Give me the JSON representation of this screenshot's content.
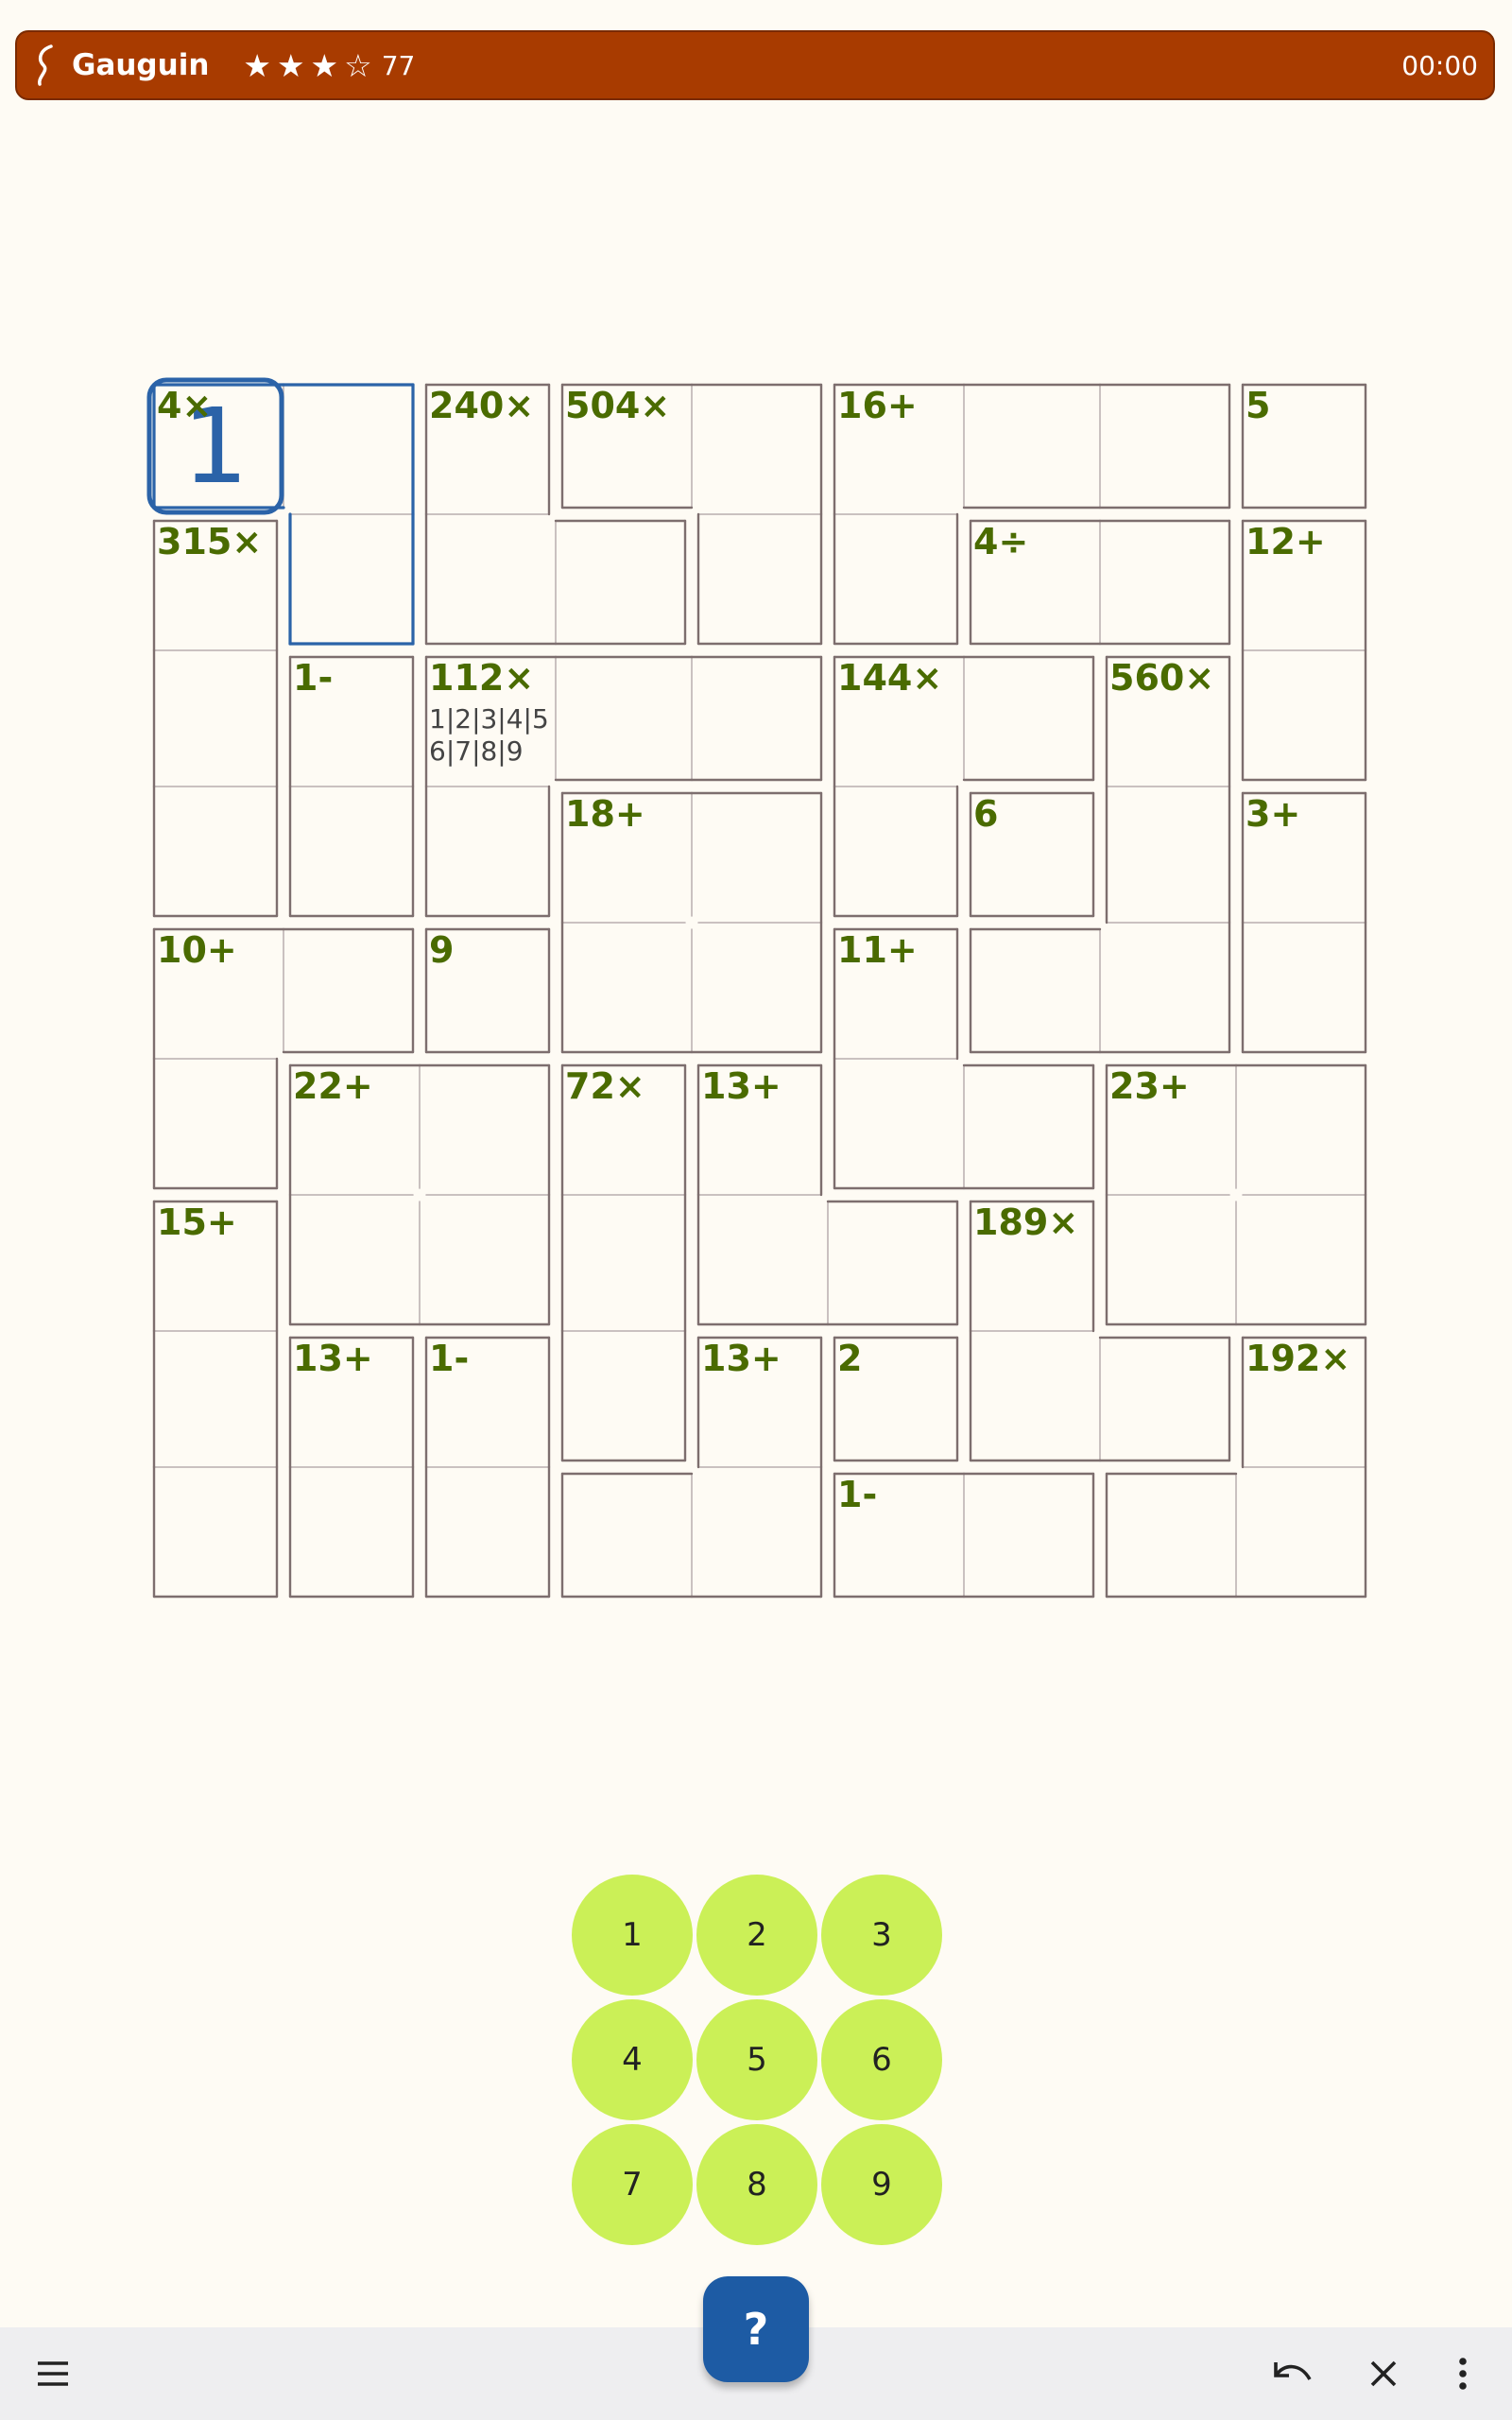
{
  "header": {
    "title": "Gauguin",
    "stars": "★★★☆",
    "score": "77",
    "timer": "00:00",
    "bar_color": "#a83b00"
  },
  "grid": {
    "size": 9,
    "clues": [
      {
        "row": 0,
        "col": 0,
        "text": "4×"
      },
      {
        "row": 0,
        "col": 2,
        "text": "240×"
      },
      {
        "row": 0,
        "col": 3,
        "text": "504×"
      },
      {
        "row": 0,
        "col": 5,
        "text": "16+"
      },
      {
        "row": 0,
        "col": 8,
        "text": "5"
      },
      {
        "row": 1,
        "col": 0,
        "text": "315×"
      },
      {
        "row": 1,
        "col": 6,
        "text": "4÷"
      },
      {
        "row": 1,
        "col": 8,
        "text": "12+"
      },
      {
        "row": 2,
        "col": 1,
        "text": "1-"
      },
      {
        "row": 2,
        "col": 2,
        "text": "112×"
      },
      {
        "row": 2,
        "col": 5,
        "text": "144×"
      },
      {
        "row": 2,
        "col": 7,
        "text": "560×"
      },
      {
        "row": 3,
        "col": 3,
        "text": "18+"
      },
      {
        "row": 3,
        "col": 6,
        "text": "6"
      },
      {
        "row": 3,
        "col": 8,
        "text": "3+"
      },
      {
        "row": 4,
        "col": 0,
        "text": "10+"
      },
      {
        "row": 4,
        "col": 2,
        "text": "9"
      },
      {
        "row": 4,
        "col": 5,
        "text": "11+"
      },
      {
        "row": 5,
        "col": 1,
        "text": "22+"
      },
      {
        "row": 5,
        "col": 3,
        "text": "72×"
      },
      {
        "row": 5,
        "col": 4,
        "text": "13+"
      },
      {
        "row": 5,
        "col": 7,
        "text": "23+"
      },
      {
        "row": 6,
        "col": 0,
        "text": "15+"
      },
      {
        "row": 6,
        "col": 6,
        "text": "189×"
      },
      {
        "row": 7,
        "col": 1,
        "text": "13+"
      },
      {
        "row": 7,
        "col": 2,
        "text": "1-"
      },
      {
        "row": 7,
        "col": 4,
        "text": "13+"
      },
      {
        "row": 7,
        "col": 5,
        "text": "2"
      },
      {
        "row": 7,
        "col": 8,
        "text": "192×"
      },
      {
        "row": 8,
        "col": 5,
        "text": "1-"
      }
    ],
    "values": [
      {
        "row": 0,
        "col": 0,
        "text": "1"
      }
    ],
    "pencil_marks": [
      {
        "row": 2,
        "col": 2,
        "text": "1|2|3|4|5\n6|7|8|9"
      }
    ],
    "selected_cage": [
      [
        0,
        0
      ],
      [
        0,
        1
      ],
      [
        1,
        1
      ]
    ],
    "selected_cell": [
      0,
      0
    ],
    "cages": [
      [
        [
          0,
          0
        ],
        [
          0,
          1
        ],
        [
          1,
          1
        ]
      ],
      [
        [
          0,
          2
        ],
        [
          1,
          2
        ],
        [
          1,
          3
        ]
      ],
      [
        [
          0,
          3
        ],
        [
          0,
          4
        ],
        [
          1,
          4
        ]
      ],
      [
        [
          0,
          5
        ],
        [
          0,
          6
        ],
        [
          0,
          7
        ],
        [
          1,
          5
        ]
      ],
      [
        [
          0,
          8
        ]
      ],
      [
        [
          1,
          0
        ],
        [
          2,
          0
        ],
        [
          3,
          0
        ]
      ],
      [
        [
          1,
          6
        ],
        [
          1,
          7
        ]
      ],
      [
        [
          1,
          8
        ],
        [
          2,
          8
        ]
      ],
      [
        [
          2,
          1
        ],
        [
          3,
          1
        ]
      ],
      [
        [
          2,
          2
        ],
        [
          2,
          3
        ],
        [
          2,
          4
        ],
        [
          3,
          2
        ]
      ],
      [
        [
          2,
          5
        ],
        [
          2,
          6
        ],
        [
          3,
          5
        ]
      ],
      [
        [
          2,
          7
        ],
        [
          3,
          7
        ],
        [
          4,
          6
        ],
        [
          4,
          7
        ]
      ],
      [
        [
          3,
          3
        ],
        [
          3,
          4
        ],
        [
          4,
          3
        ],
        [
          4,
          4
        ]
      ],
      [
        [
          3,
          6
        ]
      ],
      [
        [
          3,
          8
        ],
        [
          4,
          8
        ]
      ],
      [
        [
          4,
          0
        ],
        [
          4,
          1
        ],
        [
          5,
          0
        ]
      ],
      [
        [
          4,
          2
        ]
      ],
      [
        [
          4,
          5
        ],
        [
          5,
          5
        ],
        [
          5,
          6
        ]
      ],
      [
        [
          5,
          1
        ],
        [
          5,
          2
        ],
        [
          6,
          1
        ],
        [
          6,
          2
        ]
      ],
      [
        [
          5,
          3
        ],
        [
          6,
          3
        ],
        [
          7,
          3
        ]
      ],
      [
        [
          5,
          4
        ],
        [
          6,
          4
        ],
        [
          6,
          5
        ]
      ],
      [
        [
          5,
          7
        ],
        [
          5,
          8
        ],
        [
          6,
          7
        ],
        [
          6,
          8
        ]
      ],
      [
        [
          6,
          0
        ],
        [
          7,
          0
        ],
        [
          8,
          0
        ]
      ],
      [
        [
          6,
          6
        ],
        [
          7,
          6
        ],
        [
          7,
          7
        ]
      ],
      [
        [
          7,
          1
        ],
        [
          8,
          1
        ]
      ],
      [
        [
          7,
          2
        ],
        [
          8,
          2
        ]
      ],
      [
        [
          7,
          4
        ],
        [
          8,
          3
        ],
        [
          8,
          4
        ]
      ],
      [
        [
          7,
          5
        ]
      ],
      [
        [
          7,
          8
        ],
        [
          8,
          7
        ],
        [
          8,
          8
        ]
      ],
      [
        [
          8,
          5
        ],
        [
          8,
          6
        ]
      ]
    ],
    "cage_border_color": "#7d6e6e",
    "inner_line_color": "#b8aeae",
    "selection_color": "#2b63a8",
    "clue_color": "#4a6b00"
  },
  "keypad": {
    "keys": [
      "1",
      "2",
      "3",
      "4",
      "5",
      "6",
      "7",
      "8",
      "9"
    ],
    "color": "#cbf057"
  },
  "hint_button": {
    "label": "?",
    "color": "#1d5ba4"
  },
  "bottom_bar": {
    "menu_icon": "hamburger-menu-icon",
    "undo_icon": "undo-icon",
    "clear_icon": "close-icon",
    "more_icon": "more-vertical-icon"
  }
}
